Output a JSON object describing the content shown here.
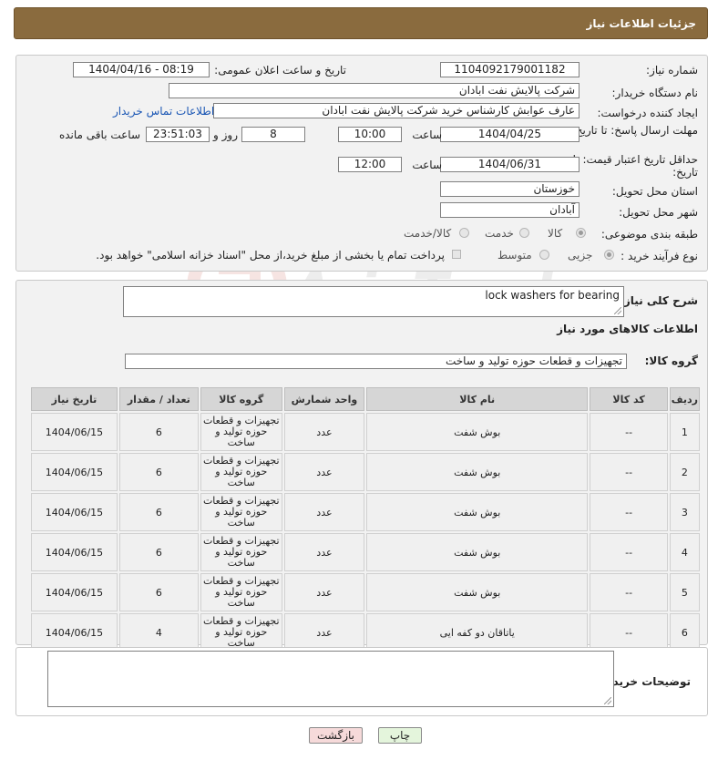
{
  "header": {
    "title": "جزئیات اطلاعات نیاز"
  },
  "form": {
    "need_number_label": "شماره نیاز:",
    "need_number": "1104092179001182",
    "announce_label": "تاریخ و ساعت اعلان عمومی:",
    "announce_value": "1404/04/16 - 08:19",
    "buyer_org_label": "نام دستگاه خریدار:",
    "buyer_org": "شرکت پالایش نفت ابادان",
    "creator_label": "ایجاد کننده درخواست:",
    "creator": "عارف عوابش کارشناس خرید شرکت پالایش نفت ابادان",
    "contact_link": "اطلاعات تماس خریدار",
    "reply_deadline_label": "مهلت ارسال پاسخ: تا تاریخ:",
    "reply_date": "1404/04/25",
    "time_label": "ساعت",
    "reply_time": "10:00",
    "days_value": "8",
    "days_label": "روز و",
    "remaining_time": "23:51:03",
    "remaining_label": "ساعت باقی مانده",
    "price_validity_label": "حداقل تاریخ اعتبار قیمت: تا تاریخ:",
    "price_date": "1404/06/31",
    "price_time": "12:00",
    "province_label": "استان محل تحویل:",
    "province": "خوزستان",
    "city_label": "شهر محل تحویل:",
    "city": "آبادان",
    "category_label": "طبقه بندی موضوعی:",
    "category_options": [
      "کالا",
      "خدمت",
      "کالا/خدمت"
    ],
    "category_selected": "کالا",
    "process_label": "نوع فرآیند خرید :",
    "process_options": [
      "جزیی",
      "متوسط"
    ],
    "process_note": "پرداخت تمام یا بخشی از مبلغ خرید،از محل \"اسناد خزانه اسلامی\" خواهد بود."
  },
  "description": {
    "label": "شرح کلی نیاز:",
    "value": "lock washers for bearing",
    "goods_info_title": "اطلاعات کالاهای مورد نیاز",
    "goods_group_label": "گروه کالا:",
    "goods_group_value": "تجهیزات و قطعات حوزه تولید و ساخت"
  },
  "table": {
    "headers": [
      "ردیف",
      "کد کالا",
      "نام کالا",
      "واحد شمارش",
      "گروه کالا",
      "تعداد / مقدار",
      "تاریخ نیاز"
    ],
    "rows": [
      [
        "1",
        "--",
        "بوش شفت",
        "عدد",
        "تجهیزات و قطعات حوزه تولید و ساخت",
        "6",
        "1404/06/15"
      ],
      [
        "2",
        "--",
        "بوش شفت",
        "عدد",
        "تجهیزات و قطعات حوزه تولید و ساخت",
        "6",
        "1404/06/15"
      ],
      [
        "3",
        "--",
        "بوش شفت",
        "عدد",
        "تجهیزات و قطعات حوزه تولید و ساخت",
        "6",
        "1404/06/15"
      ],
      [
        "4",
        "--",
        "بوش شفت",
        "عدد",
        "تجهیزات و قطعات حوزه تولید و ساخت",
        "6",
        "1404/06/15"
      ],
      [
        "5",
        "--",
        "بوش شفت",
        "عدد",
        "تجهیزات و قطعات حوزه تولید و ساخت",
        "6",
        "1404/06/15"
      ],
      [
        "6",
        "--",
        "یاتاقان دو کفه ایی",
        "عدد",
        "تجهیزات و قطعات حوزه تولید و ساخت",
        "4",
        "1404/06/15"
      ]
    ]
  },
  "buyer_notes": {
    "label": "توضیحات خریدار:",
    "value": ""
  },
  "buttons": {
    "print": "چاپ",
    "back": "بازگشت"
  },
  "watermark": {
    "text": "AriaTender.neT"
  },
  "colors": {
    "header_bg": "#8a6b3e",
    "link": "#1a56b4",
    "print_btn": "#e4f5dc",
    "back_btn": "#f6dada"
  }
}
